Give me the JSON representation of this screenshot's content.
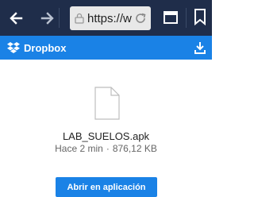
{
  "browser": {
    "url": "https://w",
    "back_icon": "back-arrow-icon",
    "forward_icon": "forward-arrow-icon",
    "tabs_count": "1"
  },
  "app_bar": {
    "title": "Dropbox",
    "color": "#1a82e6"
  },
  "file": {
    "name": "LAB_SUELOS.apk",
    "time": "Hace 2 min",
    "separator": "·",
    "size": "876,12 KB"
  },
  "actions": {
    "open_label": "Abrir en aplicación"
  }
}
